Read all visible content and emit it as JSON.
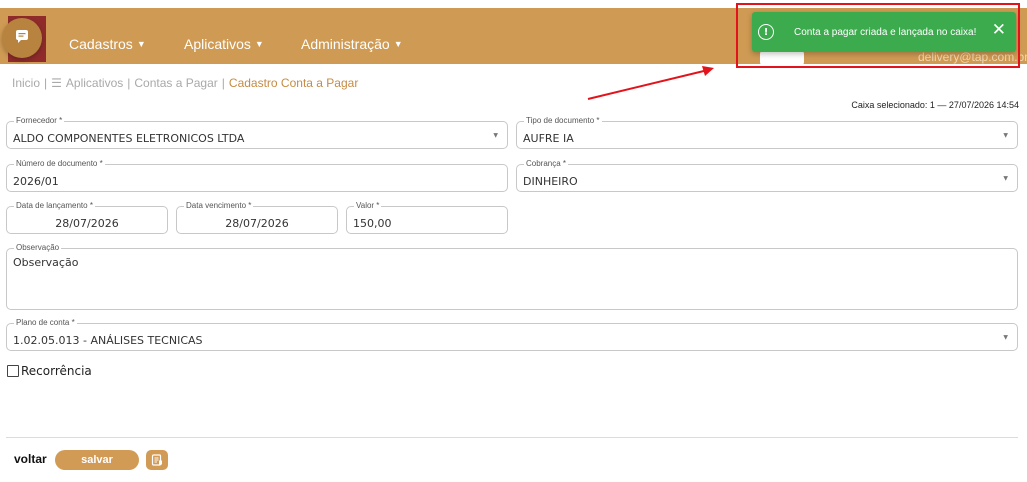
{
  "nav": {
    "menus": [
      {
        "label": "Cadastros"
      },
      {
        "label": "Aplicativos"
      },
      {
        "label": "Administração"
      }
    ],
    "user_email": "delivery@tap.com.br",
    "brand_color": "#cf9a53"
  },
  "toast": {
    "message": "Conta a pagar criada e lançada no caixa!",
    "icon": "alert-circle-icon",
    "close_icon": "close-icon",
    "color": "#3cab4d"
  },
  "breadcrumb": {
    "items": [
      "Inicio",
      "Aplicativos",
      "Contas a Pagar"
    ],
    "current": "Cadastro Conta a Pagar",
    "separator": "|"
  },
  "caixa": "Caixa selecionado: 1 — 27/07/2026 14:54",
  "form": {
    "fornecedor": {
      "label": "Fornecedor *",
      "value": "ALDO COMPONENTES ELETRONICOS LTDA"
    },
    "tipo_documento": {
      "label": "Tipo de documento *",
      "value": "AUFRE IA"
    },
    "numero_documento": {
      "label": "Número de documento *",
      "value": "2026/01"
    },
    "cobranca": {
      "label": "Cobrança *",
      "value": "DINHEIRO"
    },
    "data_lancamento": {
      "label": "Data de lançamento *",
      "value": "28/07/2026"
    },
    "data_vencimento": {
      "label": "Data vencimento *",
      "value": "28/07/2026"
    },
    "valor": {
      "label": "Valor *",
      "value": "150,00"
    },
    "observacao": {
      "label": "Observação",
      "placeholder": "Observação"
    },
    "plano_conta": {
      "label": "Plano de conta *",
      "value": "1.02.05.013 - ANÁLISES TECNICAS"
    },
    "recorrencia": {
      "label": "Recorrência",
      "checked": false
    }
  },
  "actions": {
    "voltar": "voltar",
    "salvar": "salvar"
  }
}
